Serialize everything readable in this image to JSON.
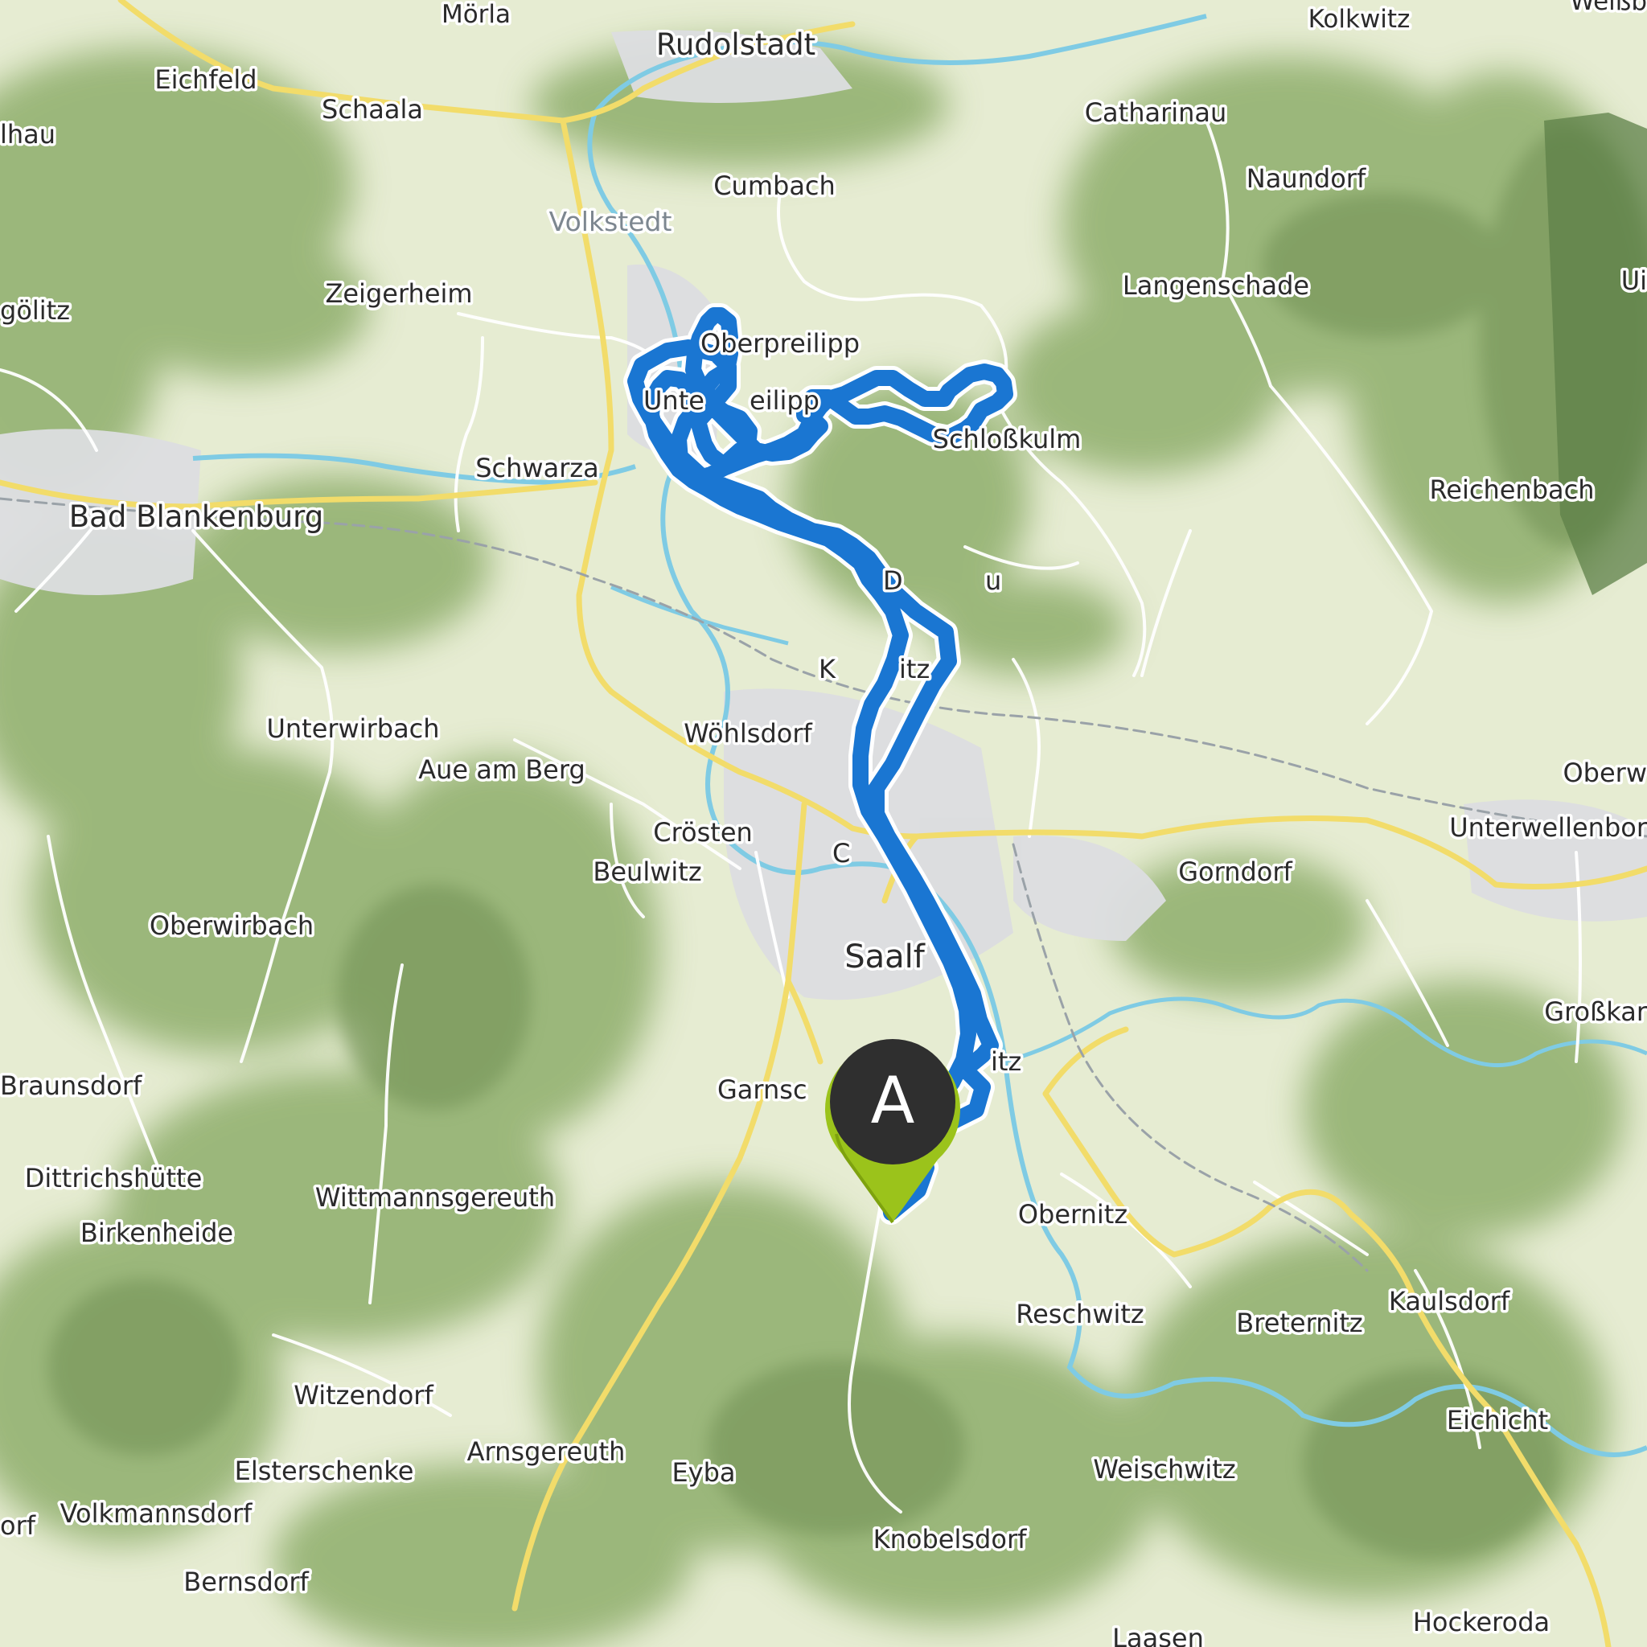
{
  "map": {
    "colors": {
      "forest": "#8fae6c",
      "meadow": "#e6ecd2",
      "urban": "#dcdde0",
      "water": "#7fcbe4",
      "road_major": "#f2dc6a",
      "road_minor": "#ffffff",
      "route": "#1a76d2",
      "route_halo": "#ffffff",
      "marker_fill": "#2f2f2f",
      "marker_ring": "#9bc31b"
    },
    "route_marker": {
      "label": "A",
      "icon": "map-pin-icon"
    },
    "places": [
      {
        "name": "Mörla",
        "class": "village"
      },
      {
        "name": "Rudolstadt",
        "class": "town"
      },
      {
        "name": "Kolkwitz",
        "class": "village"
      },
      {
        "name": "Weißb",
        "class": "village"
      },
      {
        "name": "Eichfeld",
        "class": "village"
      },
      {
        "name": "Schaala",
        "class": "village"
      },
      {
        "name": "Catharinau",
        "class": "village"
      },
      {
        "name": "lhau",
        "class": "village"
      },
      {
        "name": "Cumbach",
        "class": "village"
      },
      {
        "name": "Naundorf",
        "class": "village"
      },
      {
        "name": "Volkstedt",
        "class": "district"
      },
      {
        "name": "Zeigerheim",
        "class": "village"
      },
      {
        "name": "Langenschade",
        "class": "village"
      },
      {
        "name": "gölitz",
        "class": "village"
      },
      {
        "name": "Ui",
        "class": "village"
      },
      {
        "name": "Oberpreilipp",
        "class": "village"
      },
      {
        "name": "Unte",
        "class": "village"
      },
      {
        "name": "eilipp",
        "class": "village"
      },
      {
        "name": "Schloßkulm",
        "class": "village"
      },
      {
        "name": "Schwarza",
        "class": "village"
      },
      {
        "name": "Reichenbach",
        "class": "village"
      },
      {
        "name": "Bad Blankenburg",
        "class": "town"
      },
      {
        "name": "D",
        "class": "village"
      },
      {
        "name": "u",
        "class": "village"
      },
      {
        "name": "K",
        "class": "village"
      },
      {
        "name": "itz",
        "class": "village"
      },
      {
        "name": "Unterwirbach",
        "class": "village"
      },
      {
        "name": "Wöhlsdorf",
        "class": "village"
      },
      {
        "name": "Aue am Berg",
        "class": "village"
      },
      {
        "name": "Oberw",
        "class": "village"
      },
      {
        "name": "Crösten",
        "class": "village"
      },
      {
        "name": "Unterwellenbor",
        "class": "village"
      },
      {
        "name": "Beulwitz",
        "class": "village"
      },
      {
        "name": "C",
        "class": "village"
      },
      {
        "name": "Gorndorf",
        "class": "village"
      },
      {
        "name": "Oberwirbach",
        "class": "village"
      },
      {
        "name": "Saalf",
        "class": "town"
      },
      {
        "name": "Großkar",
        "class": "village"
      },
      {
        "name": "itz",
        "class": "village"
      },
      {
        "name": "Braunsdorf",
        "class": "village"
      },
      {
        "name": "Garnsc",
        "class": "village"
      },
      {
        "name": "Dittrichshütte",
        "class": "village"
      },
      {
        "name": "Wittmannsgereuth",
        "class": "village"
      },
      {
        "name": "Obernitz",
        "class": "village"
      },
      {
        "name": "Birkenheide",
        "class": "village"
      },
      {
        "name": "Reschwitz",
        "class": "village"
      },
      {
        "name": "Breternitz",
        "class": "village"
      },
      {
        "name": "Kaulsdorf",
        "class": "village"
      },
      {
        "name": "Witzendorf",
        "class": "village"
      },
      {
        "name": "Arnsgereuth",
        "class": "village"
      },
      {
        "name": "Elsterschenke",
        "class": "village"
      },
      {
        "name": "Eyba",
        "class": "village"
      },
      {
        "name": "Eichicht",
        "class": "village"
      },
      {
        "name": "Weischwitz",
        "class": "village"
      },
      {
        "name": "orf",
        "class": "village"
      },
      {
        "name": "Volkmannsdorf",
        "class": "village"
      },
      {
        "name": "Knobelsdorf",
        "class": "village"
      },
      {
        "name": "Bernsdorf",
        "class": "village"
      },
      {
        "name": "Hockeroda",
        "class": "village"
      },
      {
        "name": "Laasen",
        "class": "village"
      }
    ]
  }
}
